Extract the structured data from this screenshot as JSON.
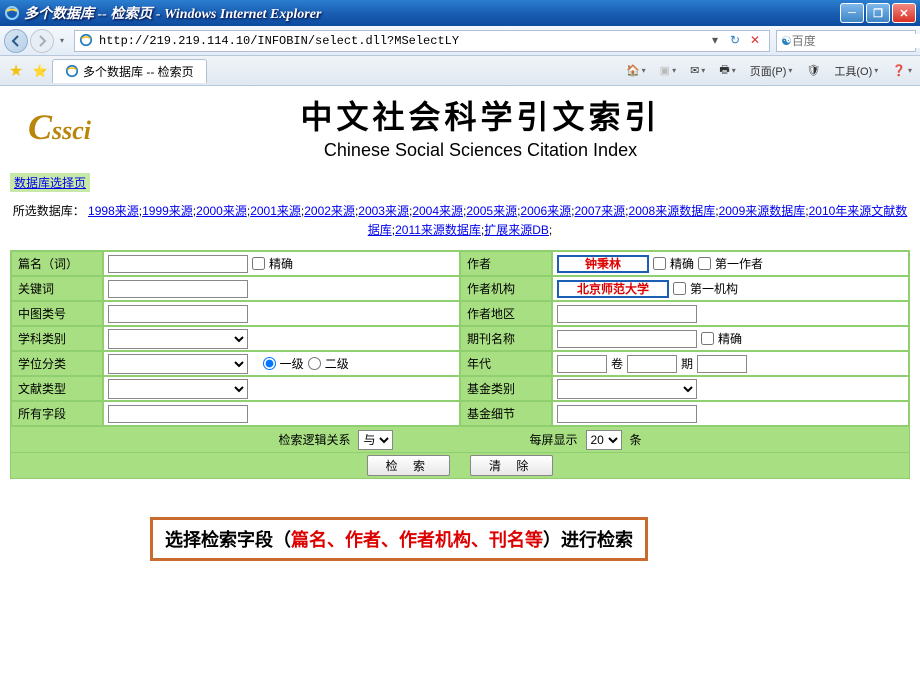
{
  "window": {
    "title": "多个数据库 -- 检索页 - Windows Internet Explorer"
  },
  "address": {
    "url": "http://219.219.114.10/INFOBIN/select.dll?MSelectLY"
  },
  "search_provider": {
    "placeholder": "百度"
  },
  "tab": {
    "title": "多个数据库 -- 检索页"
  },
  "toolbar": {
    "home": "🏠",
    "rss_on": false,
    "mail": "✉",
    "print": "🖨",
    "page": "页面(P)",
    "safety": "安全(S)",
    "tools": "工具(O)",
    "help": "❓"
  },
  "logo": "CSSCI",
  "title_cn": "中文社会科学引文索引",
  "title_en": "Chinese Social Sciences Citation Index",
  "nav_link_text": "数据库选择页",
  "db_label": "所选数据库：",
  "db_years": [
    "1998来源",
    "1999来源",
    "2000来源",
    "2001来源",
    "2002来源",
    "2003来源",
    "2004来源",
    "2005来源",
    "2006来源",
    "2007来源",
    "2008来源数据库",
    "2009来源数据库",
    "2010年来源文献数据库",
    "2011来源数据库",
    "扩展来源DB"
  ],
  "left_fields": {
    "title": "篇名（词）",
    "keyword": "关键词",
    "clc": "中图类号",
    "subject": "学科类别",
    "degree": "学位分类",
    "doctype": "文献类型",
    "allfields": "所有字段",
    "exact": "精确",
    "level1": "一级",
    "level2": "二级"
  },
  "right_fields": {
    "author": "作者",
    "author_val": "钟秉林",
    "author_org": "作者机构",
    "author_org_val": "北京师范大学",
    "author_region": "作者地区",
    "journal": "期刊名称",
    "year": "年代",
    "vol": "卷",
    "issue": "期",
    "fund_type": "基金类别",
    "fund_detail": "基金细节",
    "exact": "精确",
    "first_author": "第一作者",
    "first_org": "第一机构"
  },
  "logic_bar": {
    "relation_label": "检索逻辑关系",
    "relation_val": "与",
    "perpage_label": "每屏显示",
    "perpage_val": "20",
    "perpage_unit": "条"
  },
  "buttons": {
    "search": "检 索",
    "clear": "清 除"
  },
  "instruction": {
    "p1": "选择检索字段（",
    "p2": "篇名、作者、作者机构、刊名等",
    "p3": "）进行检索"
  }
}
